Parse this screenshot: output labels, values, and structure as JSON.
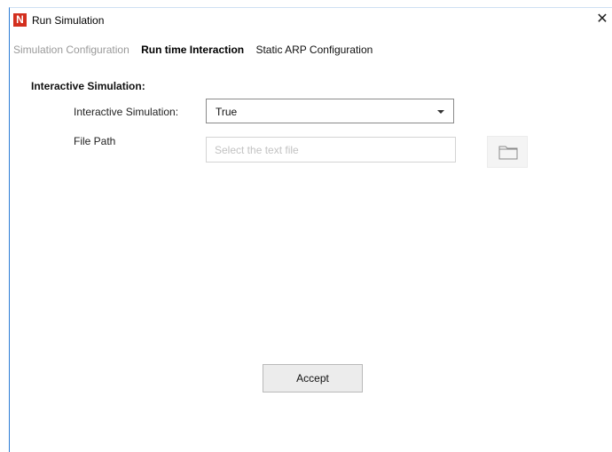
{
  "window": {
    "title": "Run Simulation",
    "logo_letter": "N",
    "close_glyph": "✕"
  },
  "tabs": [
    {
      "label": "Simulation Configuration",
      "state": "inactive"
    },
    {
      "label": "Run time Interaction",
      "state": "active"
    },
    {
      "label": "Static ARP Configuration",
      "state": "inactive"
    }
  ],
  "section": {
    "title": "Interactive Simulation:"
  },
  "form": {
    "interactive_label": "Interactive Simulation:",
    "interactive_value": "True",
    "file_path_label": "File Path",
    "file_path_value": "",
    "file_path_placeholder": "Select the text file"
  },
  "buttons": {
    "accept_label": "Accept"
  },
  "icons": {
    "browse": "folder-icon",
    "dropdown": "chevron-down-icon",
    "close": "close-icon"
  },
  "colors": {
    "logo_red": "#d32f1e",
    "window_border_blue": "#2b7bd6"
  }
}
